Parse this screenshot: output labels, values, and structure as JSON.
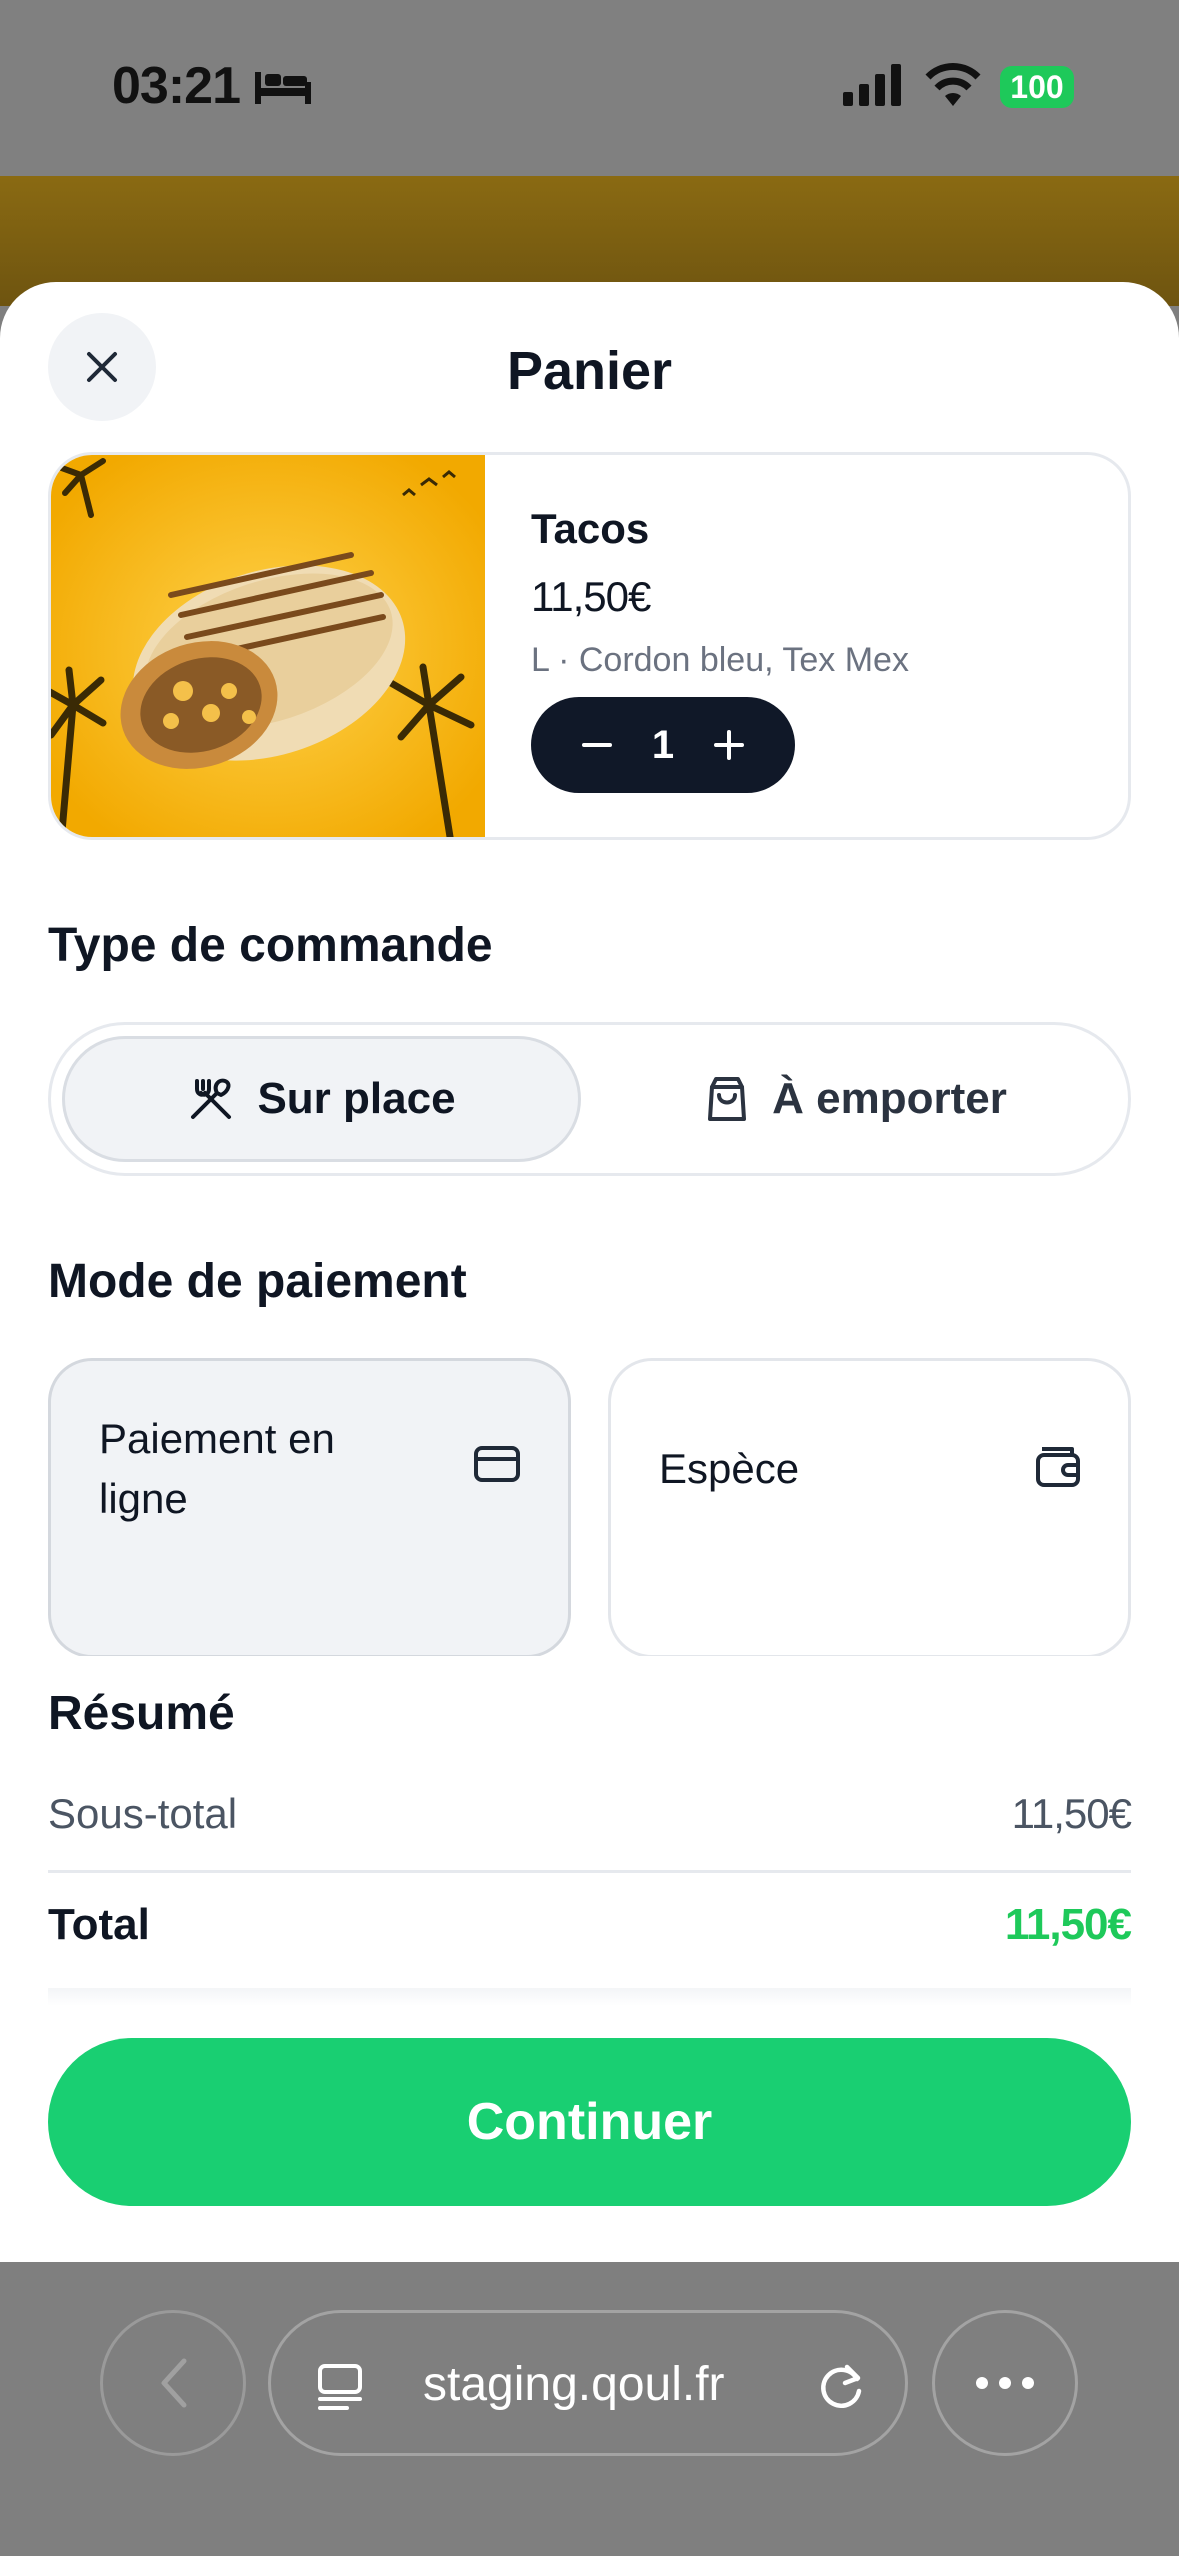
{
  "status_bar": {
    "time": "03:21",
    "battery": "100"
  },
  "sheet": {
    "title": "Panier"
  },
  "cart_item": {
    "name": "Tacos",
    "price": "11,50€",
    "options": "L · Cordon bleu, Tex Mex",
    "quantity": "1"
  },
  "order_type": {
    "title": "Type de commande",
    "options": [
      {
        "label": "Sur place",
        "icon": "utensils-crossed-icon",
        "selected": true
      },
      {
        "label": "À emporter",
        "icon": "shopping-bag-icon",
        "selected": false
      }
    ]
  },
  "payment": {
    "title": "Mode de paiement",
    "options": [
      {
        "label": "Paiement en ligne",
        "icon": "credit-card-icon",
        "selected": true
      },
      {
        "label": "Espèce",
        "icon": "wallet-icon",
        "selected": false
      }
    ]
  },
  "summary": {
    "title": "Résumé",
    "subtotal_label": "Sous-total",
    "subtotal_value": "11,50€",
    "total_label": "Total",
    "total_value": "11,50€"
  },
  "cta": {
    "label": "Continuer"
  },
  "browser": {
    "url": "staging.qoul.fr"
  },
  "colors": {
    "accent": "#19cf72",
    "dark": "#101828",
    "total": "#1ec95a"
  }
}
